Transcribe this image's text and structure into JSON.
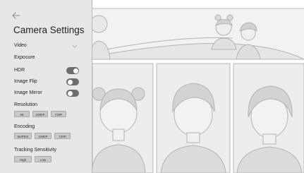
{
  "panel": {
    "back_icon": "arrow-left-icon",
    "title": "Camera Settings",
    "video": {
      "value": "Video",
      "chevron_icon": "chevron-down-icon"
    },
    "exposure_label": "Exposure",
    "toggles": [
      {
        "label": "HDR",
        "state": "on"
      },
      {
        "label": "Image Flip",
        "state": "off"
      },
      {
        "label": "Image Mirror",
        "state": "off"
      }
    ],
    "resolution": {
      "label": "Resolution",
      "options": [
        "4K",
        "1080P",
        "720P"
      ]
    },
    "encoding": {
      "label": "Encoding",
      "options": [
        "MJPEG",
        "1080P",
        "720P"
      ]
    },
    "tracking": {
      "label": "Tracking Sensitivity",
      "options": [
        "High",
        "Low"
      ]
    }
  },
  "colors": {
    "panel_bg": "#e7e7e7",
    "toggle": "#6d6d6d",
    "chip_bg": "#c9c9c9",
    "illustration_fill": "#e9e9e9",
    "illustration_stroke": "#b3b3b3"
  }
}
